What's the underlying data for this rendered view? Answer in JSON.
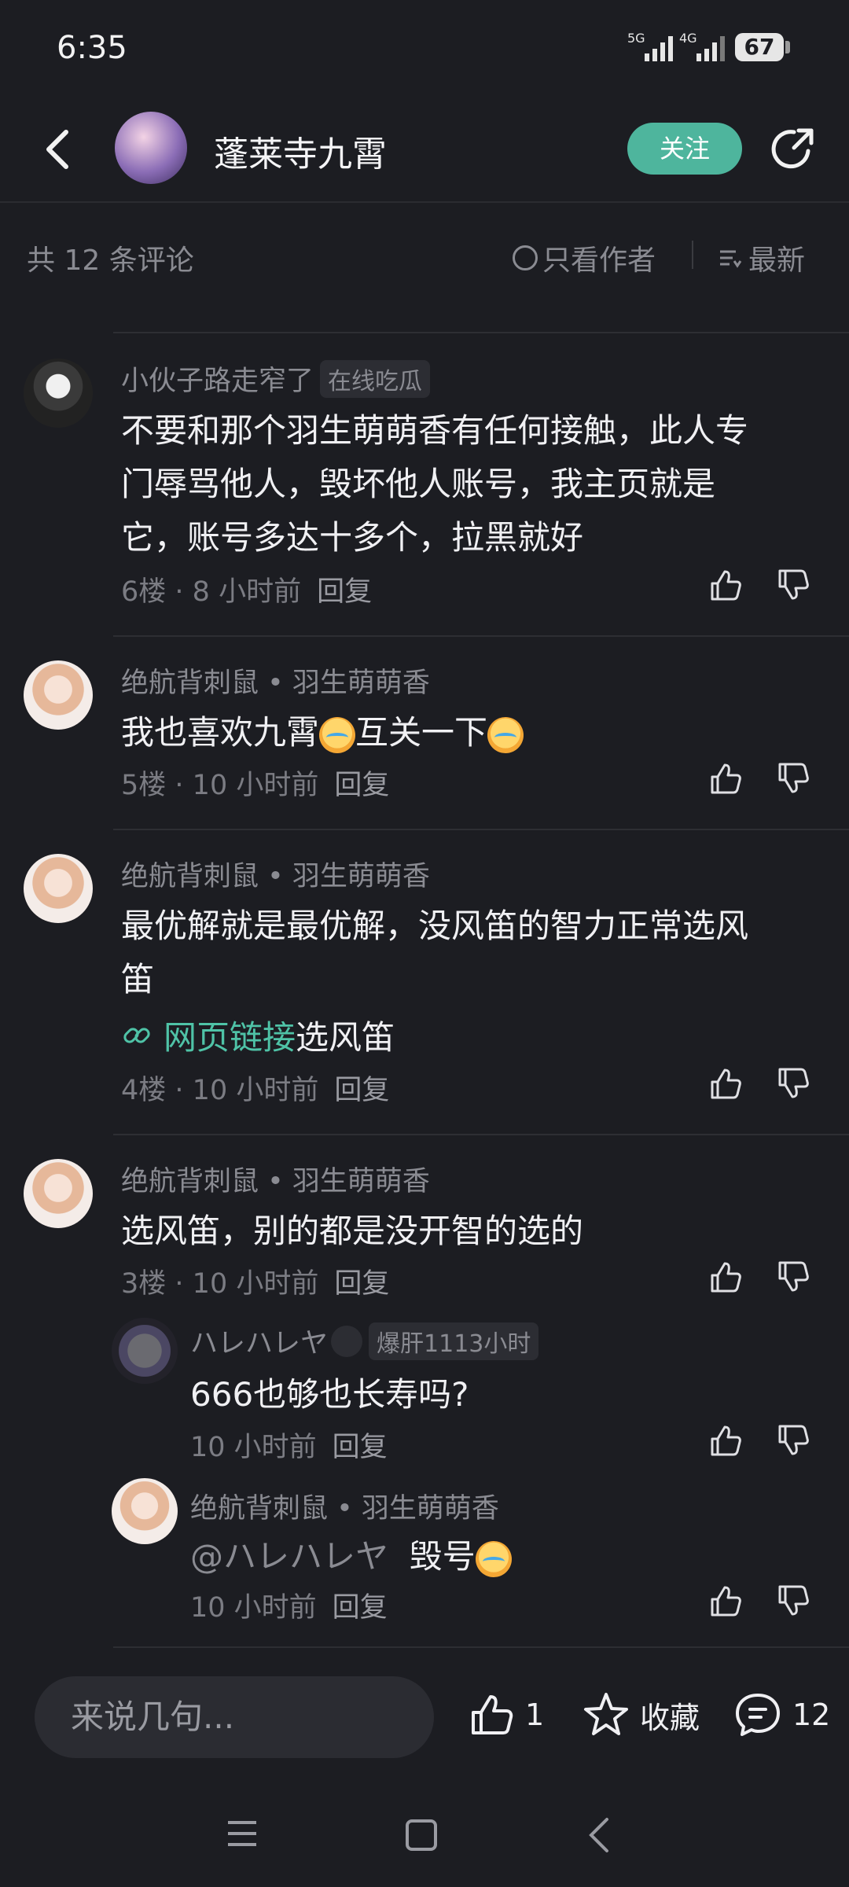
{
  "status_bar": {
    "time": "6:35",
    "net1": "5G",
    "net2": "4G",
    "battery": "67"
  },
  "header": {
    "title": "蓬莱寺九霄",
    "follow_label": "关注"
  },
  "filter_bar": {
    "count_text": "共 12 条评论",
    "only_author_label": "只看作者",
    "sort_label": "最新"
  },
  "comments": [
    {
      "user": "小伙子路走窄了",
      "badge": "在线吃瓜",
      "text_lines": [
        "不要和那个羽生萌萌香有任何接触，此人专",
        "门辱骂他人，毁坏他人账号，我主页就是",
        "它，账号多达十多个，拉黑就好"
      ],
      "floor": "6楼",
      "time": "8 小时前",
      "reply_label": "回复"
    },
    {
      "user": "绝航背刺鼠 • 羽生萌萌香",
      "text_a": "我也喜欢九霄",
      "text_b": "互关一下",
      "floor": "5楼",
      "time": "10 小时前",
      "reply_label": "回复"
    },
    {
      "user": "绝航背刺鼠 • 羽生萌萌香",
      "text_lines": [
        "最优解就是最优解，没风笛的智力正常选风",
        "笛"
      ],
      "link_text": "网页链接",
      "link_rest": "选风笛",
      "floor": "4楼",
      "time": "10 小时前",
      "reply_label": "回复"
    },
    {
      "user": "绝航背刺鼠 • 羽生萌萌香",
      "text": "选风笛，别的都是没开智的选的",
      "floor": "3楼",
      "time": "10 小时前",
      "reply_label": "回复"
    }
  ],
  "replies": [
    {
      "user": "ハレハレヤ",
      "badge": "爆肝1113小时",
      "text": "666也够也长寿吗?",
      "time": "10 小时前",
      "reply_label": "回复"
    },
    {
      "user": "绝航背刺鼠 • 羽生萌萌香",
      "mention": "@ハレハレヤ",
      "text": "毁号",
      "time": "10 小时前",
      "reply_label": "回复"
    }
  ],
  "bottom_bar": {
    "input_placeholder": "来说几句...",
    "like_count": "1",
    "favorite_label": "收藏",
    "comment_count": "12"
  }
}
